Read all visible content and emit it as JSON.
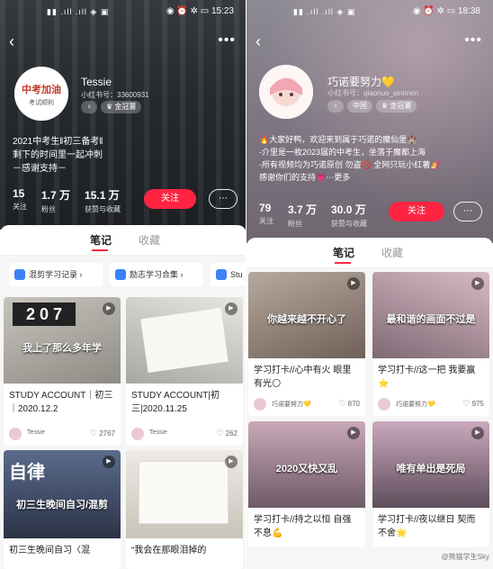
{
  "screen1": {
    "status_time": "15:23",
    "status_left": "▮▮ .ıll .ıll ◈ ▣",
    "status_right_icons": "◉ ⏰ ✲ ▭",
    "nickname": "Tessie",
    "uid": "小红书号：33600931",
    "tags": [
      "♀",
      "♛ 金冠薯"
    ],
    "bio": [
      "2021中考生‖初三备考‖",
      "剩下的时间里一起冲刺",
      "－感谢支持－"
    ],
    "stats": [
      {
        "num": "15",
        "label": "关注"
      },
      {
        "num": "1.7 万",
        "label": "粉丝"
      },
      {
        "num": "15.1 万",
        "label": "获赞与收藏"
      }
    ],
    "follow_label": "关注",
    "message_icon": "⋯",
    "tabs": [
      "笔记",
      "收藏"
    ],
    "collections": [
      "混剪学习记录 ›",
      "励志学习合集 ›",
      "Stu"
    ],
    "cards": [
      {
        "overlay": "我上了那么多年学",
        "title": "STUDY ACCOUNT｜初三｜2020.12.2",
        "author": "Tessie",
        "likes": "2767"
      },
      {
        "overlay": "",
        "title": "STUDY ACCOUNT|初三|2020.11.25",
        "author": "Tessie",
        "likes": "262"
      },
      {
        "overlay": "初三生晚间自习/混剪",
        "title": "初三生晚间自习〈混",
        "author": "",
        "likes": ""
      },
      {
        "overlay": "",
        "title": "“我会在那眼泪掉的",
        "author": "",
        "likes": ""
      }
    ]
  },
  "screen2": {
    "status_time": "18:38",
    "status_left": "▮▮ .ıll .ıll ◈ ▣",
    "status_right_icons": "◉ ⏰ ✲ ▭",
    "nickname": "巧诺要努力💛",
    "uid": "小红书号：qiaonuo_ainimen",
    "tags": [
      "♀",
      "中国",
      "♛ 金冠薯"
    ],
    "bio": [
      "🔥大家好鸭，欢迎来到属于巧诺的魔仙堡🏰",
      "-介里是一枚2023届的中考生，坐落于魔都上海",
      "-所有视频均为巧诺原创 勿盗🚫 全网只玩小红薯🍠",
      "感谢你们的支持💗⋯更多"
    ],
    "stats": [
      {
        "num": "79",
        "label": "关注"
      },
      {
        "num": "3.7 万",
        "label": "粉丝"
      },
      {
        "num": "30.0 万",
        "label": "获赞与收藏"
      }
    ],
    "follow_label": "关注",
    "message_icon": "⋯",
    "tabs": [
      "笔记",
      "收藏"
    ],
    "cards": [
      {
        "overlay": "你越来越不开心了",
        "title": "学习打卡//心中有火 眼里有光🌕",
        "author": "巧诺要努力💛",
        "likes": "870"
      },
      {
        "overlay": "最和谐的画面不过是",
        "title": "学习打卡//这一把 我要赢⭐",
        "author": "巧诺要努力💛",
        "likes": "975"
      },
      {
        "overlay": "2020又快又乱",
        "title": "学习打卡//持之以恒 自强不息💪",
        "author": "",
        "likes": ""
      },
      {
        "overlay": "唯有单出是死局",
        "title": "学习打卡//夜以继日 契而不舍🌟",
        "author": "",
        "likes": ""
      }
    ],
    "watermark": "@熊猫学生Sky"
  }
}
